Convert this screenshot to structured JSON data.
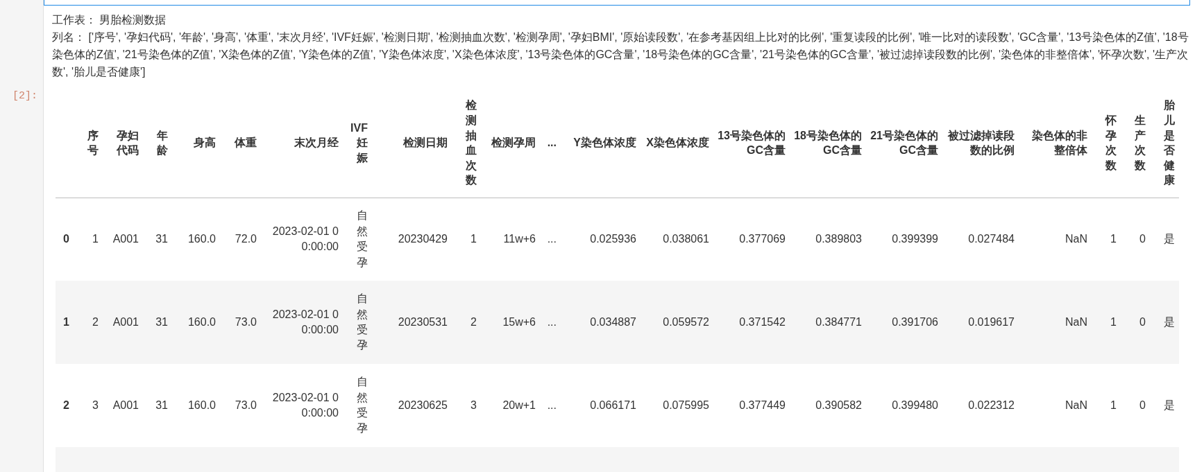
{
  "prompt": "[2]:",
  "output": {
    "sheet_line": "工作表：  男胎检测数据",
    "columns_line": "列名：  ['序号', '孕妇代码', '年龄', '身高', '体重', '末次月经', 'IVF妊娠', '检测日期', '检测抽血次数', '检测孕周', '孕妇BMI', '原始读段数', '在参考基因组上比对的比例', '重复读段的比例', '唯一比对的读段数', 'GC含量', '13号染色体的Z值', '18号染色体的Z值', '21号染色体的Z值', 'X染色体的Z值', 'Y染色体的Z值', 'Y染色体浓度', 'X染色体浓度', '13号染色体的GC含量', '18号染色体的GC含量', '21号染色体的GC含量', '被过滤掉读段数的比例', '染色体的非整倍体', '怀孕次数', '生产次数', '胎儿是否健康']"
  },
  "table": {
    "columns": [
      "序号",
      "孕妇代码",
      "年龄",
      "身高",
      "体重",
      "末次月经",
      "IVF妊娠",
      "检测日期",
      "检测抽血次数",
      "检测孕周",
      "...",
      "Y染色体浓度",
      "X染色体浓度",
      "13号染色体的GC含量",
      "18号染色体的GC含量",
      "21号染色体的GC含量",
      "被过滤掉读段数的比例",
      "染色体的非整倍体",
      "怀孕次数",
      "生产次数",
      "胎儿是否健康"
    ],
    "rows": [
      {
        "index": "0",
        "cells": [
          "1",
          "A001",
          "31",
          "160.0",
          "72.0",
          "2023-02-01 00:00:00",
          "自然受孕",
          "20230429",
          "1",
          "11w+6",
          "...",
          "0.025936",
          "0.038061",
          "0.377069",
          "0.389803",
          "0.399399",
          "0.027484",
          "NaN",
          "1",
          "0",
          "是"
        ]
      },
      {
        "index": "1",
        "cells": [
          "2",
          "A001",
          "31",
          "160.0",
          "73.0",
          "2023-02-01 00:00:00",
          "自然受孕",
          "20230531",
          "2",
          "15w+6",
          "...",
          "0.034887",
          "0.059572",
          "0.371542",
          "0.384771",
          "0.391706",
          "0.019617",
          "NaN",
          "1",
          "0",
          "是"
        ]
      },
      {
        "index": "2",
        "cells": [
          "3",
          "A001",
          "31",
          "160.0",
          "73.0",
          "2023-02-01 00:00:00",
          "自然受孕",
          "20230625",
          "3",
          "20w+1",
          "...",
          "0.066171",
          "0.075995",
          "0.377449",
          "0.390582",
          "0.399480",
          "0.022312",
          "NaN",
          "1",
          "0",
          "是"
        ]
      }
    ]
  }
}
